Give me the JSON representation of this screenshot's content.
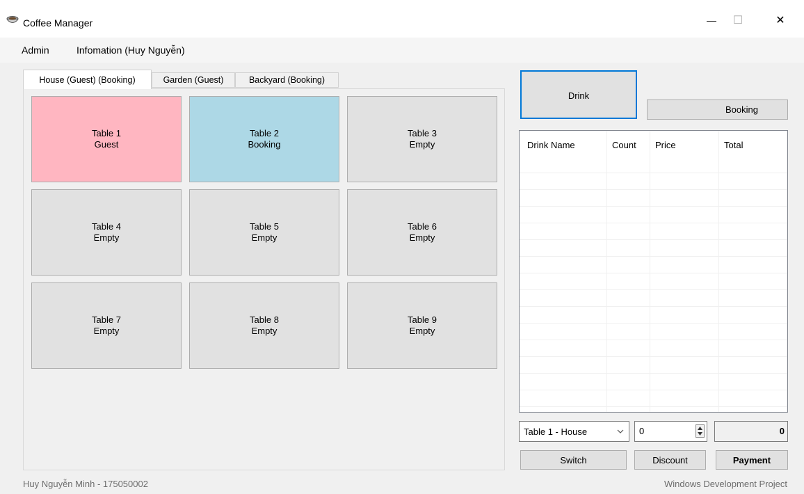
{
  "window": {
    "title": "Coffee Manager",
    "minimize_glyph": "—",
    "maximize_glyph": "☐",
    "close_glyph": "✕"
  },
  "menu": {
    "items": [
      "Admin",
      "Infomation (Huy Nguyễn)"
    ]
  },
  "tabs": [
    "House (Guest) (Booking)",
    "Garden (Guest)",
    "Backyard (Booking)"
  ],
  "tables": [
    {
      "name": "Table 1",
      "status": "Guest",
      "color": "#ffb6c1"
    },
    {
      "name": "Table 2",
      "status": "Booking",
      "color": "#add8e6"
    },
    {
      "name": "Table 3",
      "status": "Empty",
      "color": "#e1e1e1"
    },
    {
      "name": "Table 4",
      "status": "Empty",
      "color": "#e1e1e1"
    },
    {
      "name": "Table 5",
      "status": "Empty",
      "color": "#e1e1e1"
    },
    {
      "name": "Table 6",
      "status": "Empty",
      "color": "#e1e1e1"
    },
    {
      "name": "Table 7",
      "status": "Empty",
      "color": "#e1e1e1"
    },
    {
      "name": "Table 8",
      "status": "Empty",
      "color": "#e1e1e1"
    },
    {
      "name": "Table 9",
      "status": "Empty",
      "color": "#e1e1e1"
    }
  ],
  "right": {
    "drink_label": "Drink",
    "booking_label": "Booking",
    "columns": [
      "Drink Name",
      "Count",
      "Price",
      "Total"
    ],
    "table_select": "Table 1 - House",
    "discount_value": "0",
    "total_value": "0",
    "switch_label": "Switch",
    "discount_label": "Discount",
    "payment_label": "Payment"
  },
  "status": {
    "left": "Huy Nguyễn Minh - 175050002",
    "right": "Windows Development Project"
  },
  "colors": {
    "guest": "#ffb6c1",
    "booking": "#add8e6",
    "empty": "#e1e1e1",
    "focus_border": "#0078d7"
  }
}
